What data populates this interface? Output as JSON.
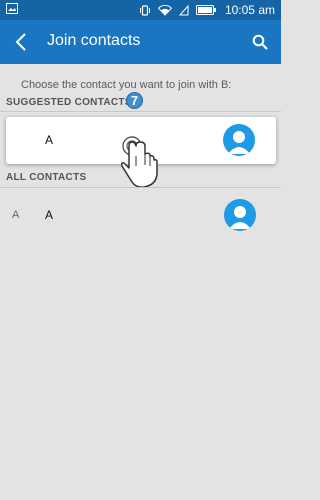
{
  "status_bar": {
    "time": "10:05 am"
  },
  "app_bar": {
    "title": "Join contacts"
  },
  "instruction": "Choose the contact you want to join with B:",
  "suggested": {
    "header": "SUGGESTED CONTACTS",
    "badge": "7",
    "contacts": [
      {
        "name": "A"
      }
    ]
  },
  "all_contacts": {
    "header": "ALL CONTACTS",
    "rows": [
      {
        "index_letter": "A",
        "name": "A"
      }
    ]
  },
  "colors": {
    "status_bar": "#1565a6",
    "app_bar": "#1a76c2",
    "background": "#e3e3e3",
    "avatar": "#1f9be6"
  }
}
